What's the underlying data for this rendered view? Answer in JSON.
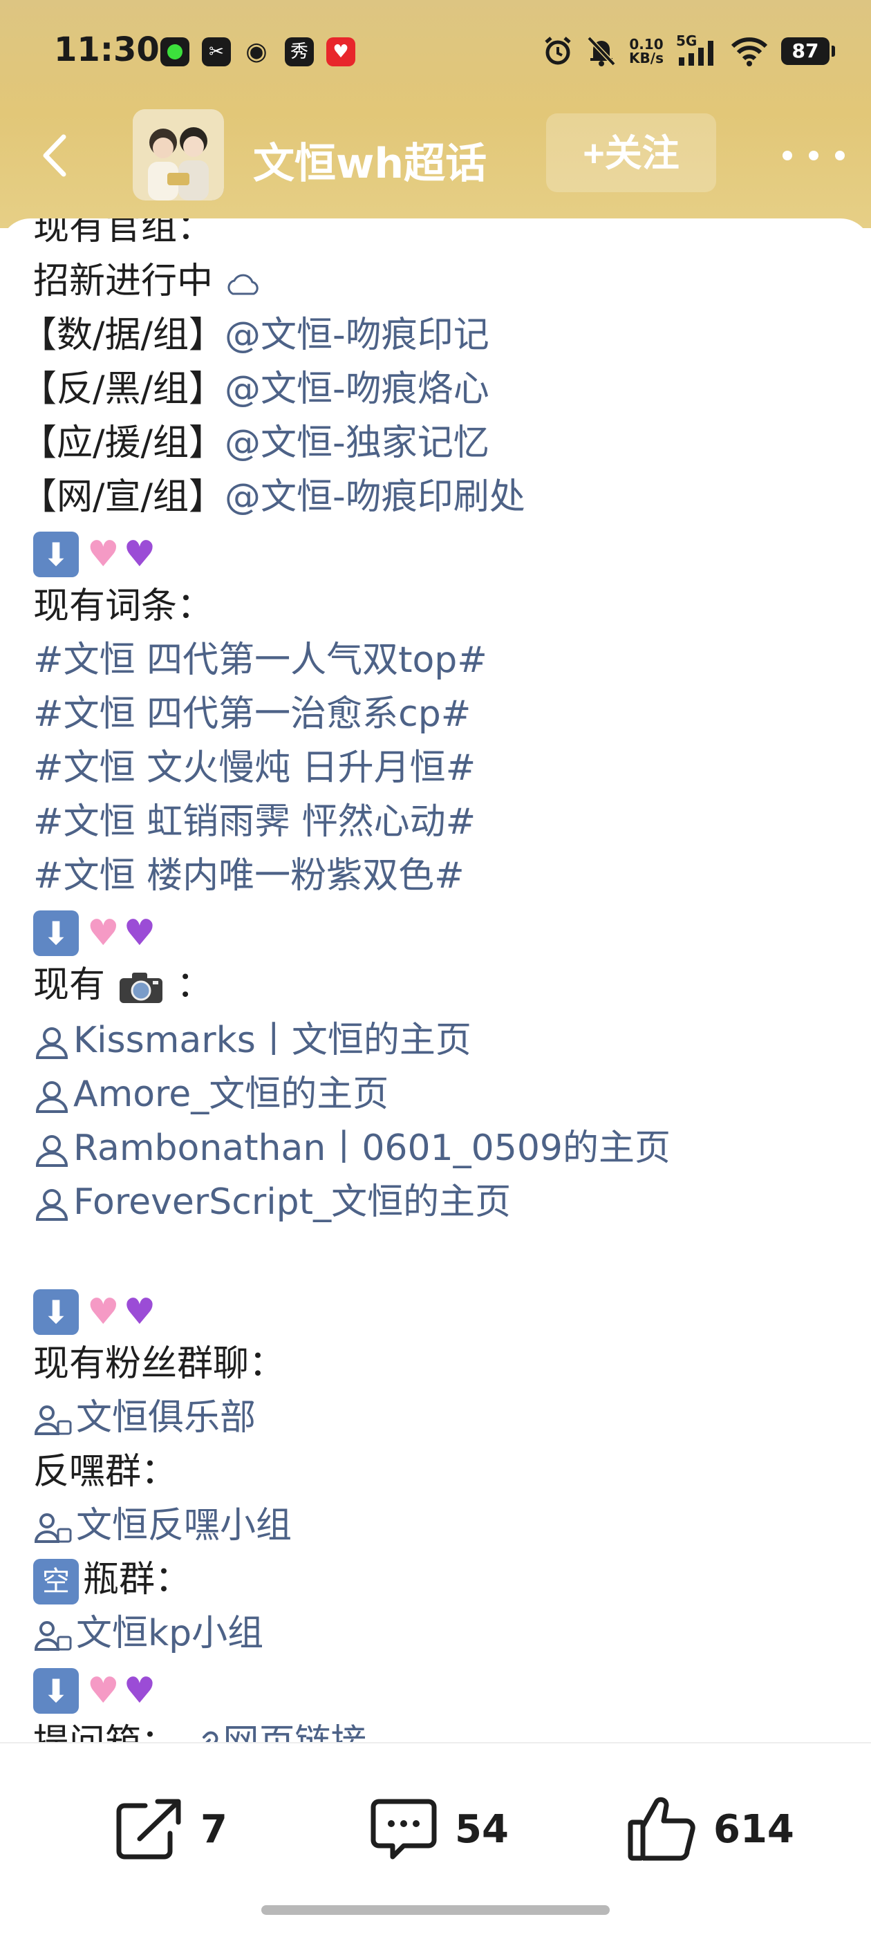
{
  "status_bar": {
    "time": "11:30",
    "net_speed_value": "0.10",
    "net_speed_unit": "KB/s",
    "network": "5G",
    "battery": "87"
  },
  "nav": {
    "title": "文恒wh超话",
    "follow_label": "+关注"
  },
  "post": {
    "line1": "现有官组：",
    "line2": "招新进行中",
    "groups": [
      {
        "prefix": "【数/据/组】",
        "handle": "@文恒-吻痕印记"
      },
      {
        "prefix": "【反/黑/组】",
        "handle": "@文恒-吻痕烙心"
      },
      {
        "prefix": "【应/援/组】",
        "handle": "@文恒-独家记忆"
      },
      {
        "prefix": "【网/宣/组】",
        "handle": "@文恒-吻痕印刷处"
      }
    ],
    "tags_heading": "现有词条：",
    "tags": [
      "#文恒 四代第一人气双top#",
      "#文恒 四代第一治愈系cp#",
      "#文恒 文火慢炖 日升月恒#",
      "#文恒 虹销雨霁 怦然心动#",
      "#文恒 楼内唯一粉紫双色#"
    ],
    "photo_heading_prefix": "现有",
    "photo_heading_suffix": "：",
    "photographers": [
      "Kissmarks丨文恒的主页",
      "Amore_文恒的主页",
      "Rambonathan丨0601_0509的主页",
      "ForeverScript_文恒的主页"
    ],
    "fan_groups_heading": "现有粉丝群聊：",
    "fan_group": "文恒俱乐部",
    "anti_heading": "反嘿群：",
    "anti_group": "文恒反嘿小组",
    "kong_char": "空",
    "bottle_heading": "瓶群：",
    "bottle_group": "文恒kp小组",
    "question_heading": "提问箱：",
    "question_link": "网页链接"
  },
  "actions": {
    "share_count": "7",
    "comment_count": "54",
    "like_count": "614"
  },
  "colors": {
    "header_gold": "#e2c778",
    "link_blue": "#4d6287",
    "pink_heart": "#f59ac5",
    "purple_heart": "#9b4cd6",
    "keycap_blue": "#5f87c4"
  }
}
